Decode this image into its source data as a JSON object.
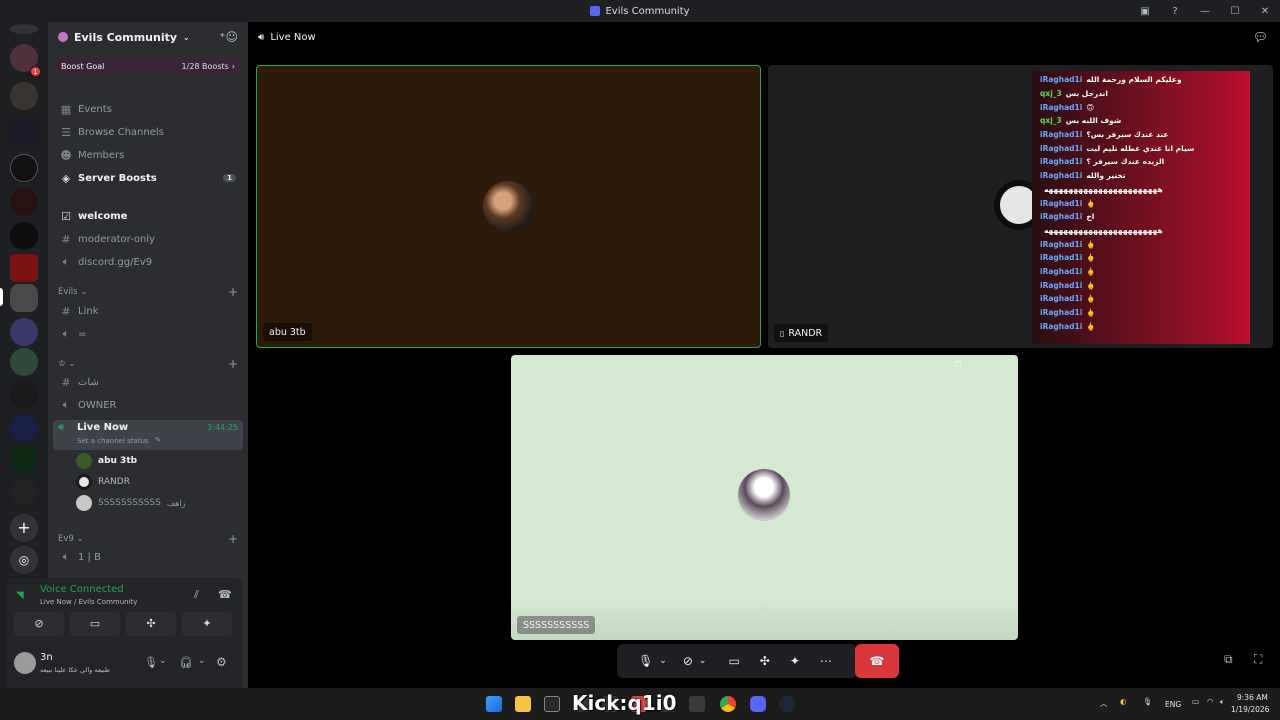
{
  "window": {
    "title": "Evils Community",
    "buttons": [
      "—",
      "☐",
      "✕"
    ]
  },
  "server": {
    "name": "Evils Community",
    "boost_label": "Boost Goal",
    "boost_count": "1/28 Boosts",
    "server_badges": [
      "1"
    ]
  },
  "nav": [
    {
      "label": "Events",
      "icon": "calendar-icon"
    },
    {
      "label": "Browse Channels",
      "icon": "channels-icon"
    },
    {
      "label": "Members",
      "icon": "members-icon"
    },
    {
      "label": "Server Boosts",
      "icon": "boost-icon",
      "count": "1"
    }
  ],
  "channels": {
    "welcome": "welcome",
    "moderator": "moderator-only",
    "invite": "discord.gg/Ev9",
    "cat_evils": "Evils",
    "link": "Link",
    "eq": "=",
    "cat_heart": "♔",
    "chat": "شات",
    "owner": "OWNER",
    "live_now": "Live Now",
    "live_time": "3:44:25",
    "channel_status": "Set a channel status",
    "cat_ev9": "Ev9",
    "one_b": "1 | B"
  },
  "voice_users": [
    {
      "name": "abu 3tb",
      "color": "#3a5a2a"
    },
    {
      "name": "RANDR",
      "color": "#e6e6e6"
    },
    {
      "name": "SSSSSSSSSSS",
      "extra": "زاهف",
      "color": "#c8c8c8"
    }
  ],
  "voice_status": {
    "title": "Voice Connected",
    "subtitle": "Live Now / Evils Community"
  },
  "me": {
    "name": "3n",
    "status": "طبيعه والي عكا علينا نبيعه"
  },
  "main": {
    "header": "Live Now",
    "tiles": [
      {
        "name": "abu 3tb",
        "bg": "#2e1a08"
      },
      {
        "name": "RANDR",
        "bg": "#1e1f21"
      },
      {
        "name": "SSSSSSSSSSS",
        "bg": "#d4e8d2"
      }
    ]
  },
  "chat": [
    {
      "user": "iRaghad1i",
      "msg": "وعليكم السلام ورحمة الله",
      "c": "#6aa8ff"
    },
    {
      "user": "qxj_3",
      "msg": "اندرجل بس",
      "c": "#5fd45f"
    },
    {
      "user": "iRaghad1i",
      "msg": "🙃",
      "c": "#6aa8ff"
    },
    {
      "user": "qxj_3",
      "msg": "شوف اللبه بس",
      "c": "#5fd45f"
    },
    {
      "user": "iRaghad1i",
      "msg": "عند عندك سيرفر بس؟",
      "c": "#6aa8ff"
    },
    {
      "user": "iRaghad1i",
      "msg": "سيام انا عندي عطله تليم ليت",
      "c": "#6aa8ff"
    },
    {
      "user": "iRaghad1i",
      "msg": "الزيده عندك سيرفر ؟",
      "c": "#6aa8ff"
    },
    {
      "user": "iRaghad1i",
      "msg": "تختير والله",
      "c": "#6aa8ff"
    },
    {
      "user": "",
      "msg": "هههههههههههههههههههههههه",
      "c": "#ffffff"
    },
    {
      "user": "iRaghad1i",
      "msg": "🖕",
      "c": "#6aa8ff"
    },
    {
      "user": "iRaghad1i",
      "msg": "اخ",
      "c": "#6aa8ff"
    },
    {
      "user": "",
      "msg": "هههههههههههههههههههههههه",
      "c": "#ffffff"
    },
    {
      "user": "iRaghad1i",
      "msg": "🖕",
      "c": "#6aa8ff"
    },
    {
      "user": "iRaghad1i",
      "msg": "🖕",
      "c": "#6aa8ff"
    },
    {
      "user": "iRaghad1i",
      "msg": "🖕",
      "c": "#6aa8ff"
    },
    {
      "user": "iRaghad1i",
      "msg": "🖕",
      "c": "#6aa8ff"
    },
    {
      "user": "iRaghad1i",
      "msg": "🖕",
      "c": "#6aa8ff"
    },
    {
      "user": "iRaghad1i",
      "msg": "🖕",
      "c": "#6aa8ff"
    },
    {
      "user": "iRaghad1i",
      "msg": "🖕",
      "c": "#6aa8ff"
    }
  ],
  "watermark": "Kick:q1i0",
  "taskbar": {
    "lang": "ENG",
    "time": "9:36 AM",
    "date": "1/19/2026"
  },
  "colors": {
    "accent": "#5865f2",
    "green": "#23a55a",
    "danger": "#da373c"
  }
}
